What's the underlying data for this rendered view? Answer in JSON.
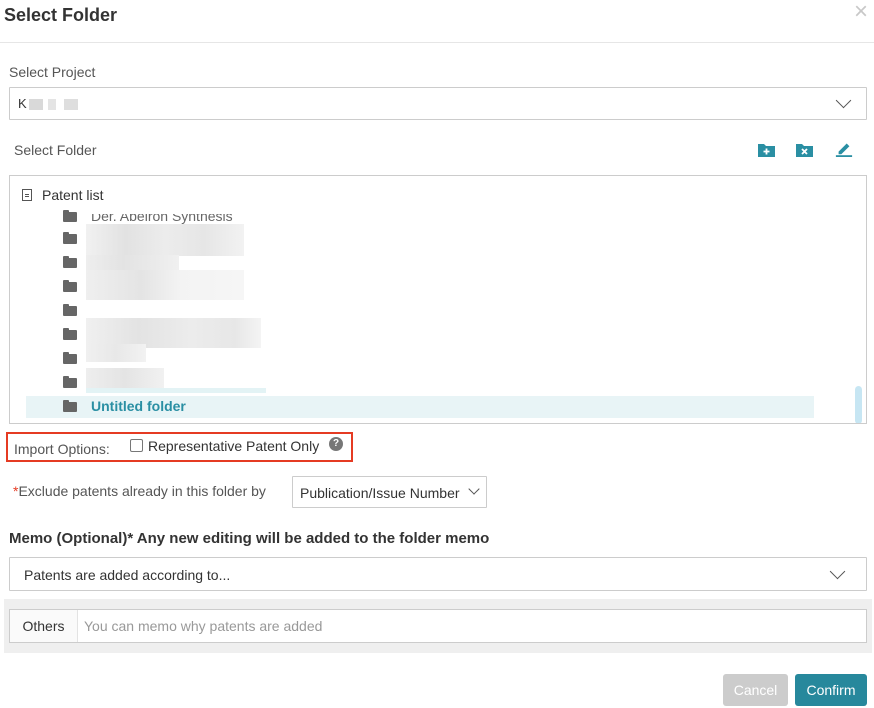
{
  "dialog": {
    "title": "Select Folder",
    "close_icon": "×"
  },
  "project": {
    "label": "Select Project",
    "value": "K"
  },
  "folder": {
    "label": "Select Folder",
    "toolbar_icons": [
      "add-folder-icon",
      "delete-folder-icon",
      "edit-icon"
    ],
    "accent_color": "#2a8fa3",
    "tree": {
      "root_label": "Patent list",
      "items": [
        {
          "label": "Der. Abeiron Synthesis",
          "redacted": false
        },
        {
          "label": "",
          "redacted": true
        },
        {
          "label": "",
          "redacted": true
        },
        {
          "label": "",
          "redacted": true
        },
        {
          "label": "",
          "redacted": true
        },
        {
          "label": "",
          "redacted": true
        },
        {
          "label": "",
          "redacted": true
        },
        {
          "label": "",
          "redacted": true
        },
        {
          "label": "Untitled folder",
          "redacted": false,
          "selected": true
        }
      ]
    }
  },
  "import_options": {
    "label": "Import Options:",
    "checkbox_label": "Representative Patent Only",
    "checked": false,
    "help_icon": "?",
    "highlight_color": "#e53b23"
  },
  "exclude": {
    "required_mark": "*",
    "label": "Exclude patents already in this folder by",
    "selected": "Publication/Issue Number"
  },
  "memo": {
    "heading": "Memo (Optional)* Any new editing will be added to the folder memo",
    "selected": "Patents are added according to...",
    "others_label": "Others",
    "others_placeholder": "You can memo why patents are added"
  },
  "buttons": {
    "cancel": "Cancel",
    "confirm": "Confirm",
    "confirm_color": "#27889c"
  }
}
